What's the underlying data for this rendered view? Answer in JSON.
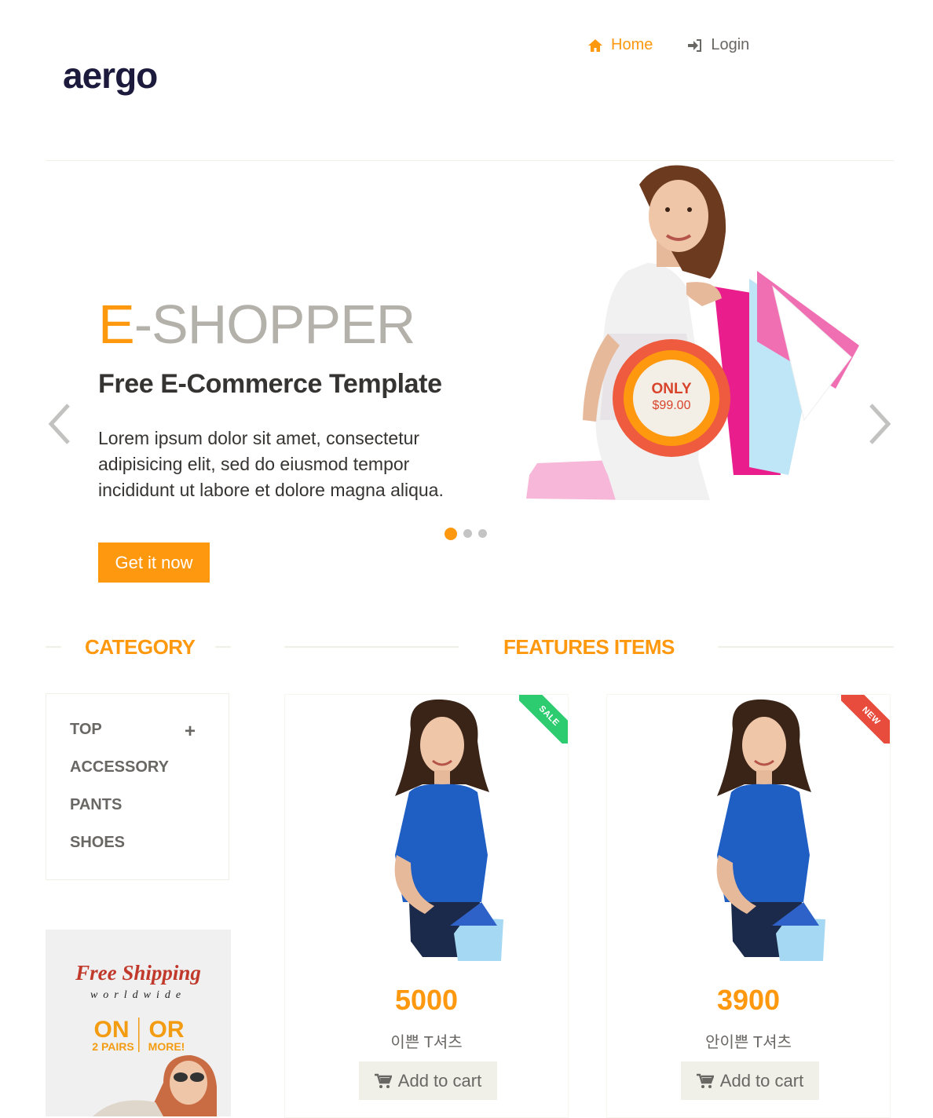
{
  "header": {
    "logo_text": "aergo",
    "nav": [
      {
        "label": "Home",
        "icon": "home-icon",
        "active": true
      },
      {
        "label": "Login",
        "icon": "login-icon",
        "active": false
      }
    ]
  },
  "slider": {
    "title_accent": "E",
    "title_rest": "-SHOPPER",
    "subtitle": "Free E-Commerce Template",
    "body": "Lorem ipsum dolor sit amet, consectetur adipisicing elit, sed do eiusmod tempor incididunt ut labore et dolore magna aliqua.",
    "cta": "Get it now",
    "badge_top": "ONLY",
    "badge_price": "$99.00",
    "active_slide": 1,
    "slide_count": 3
  },
  "category": {
    "title": "CATEGORY",
    "items": [
      "TOP",
      "ACCESSORY",
      "PANTS",
      "SHOES"
    ],
    "expand_symbol": "+"
  },
  "promo": {
    "line1": "Free Shipping",
    "line2": "worldwide",
    "on": "ON",
    "or": "OR",
    "pairs": "2 PAIRS",
    "more": "MORE!"
  },
  "features": {
    "title": "FEATURES ITEMS",
    "products": [
      {
        "price": "5000",
        "name": "이쁜 T셔츠",
        "ribbon": "SALE",
        "ribbon_color": "#2ecc71",
        "button": "Add to cart"
      },
      {
        "price": "3900",
        "name": "안이쁜 T셔츠",
        "ribbon": "NEW",
        "ribbon_color": "#e74c3c",
        "button": "Add to cart"
      }
    ]
  },
  "colors": {
    "accent": "#FE980F",
    "text": "#363432",
    "muted": "#696763"
  }
}
